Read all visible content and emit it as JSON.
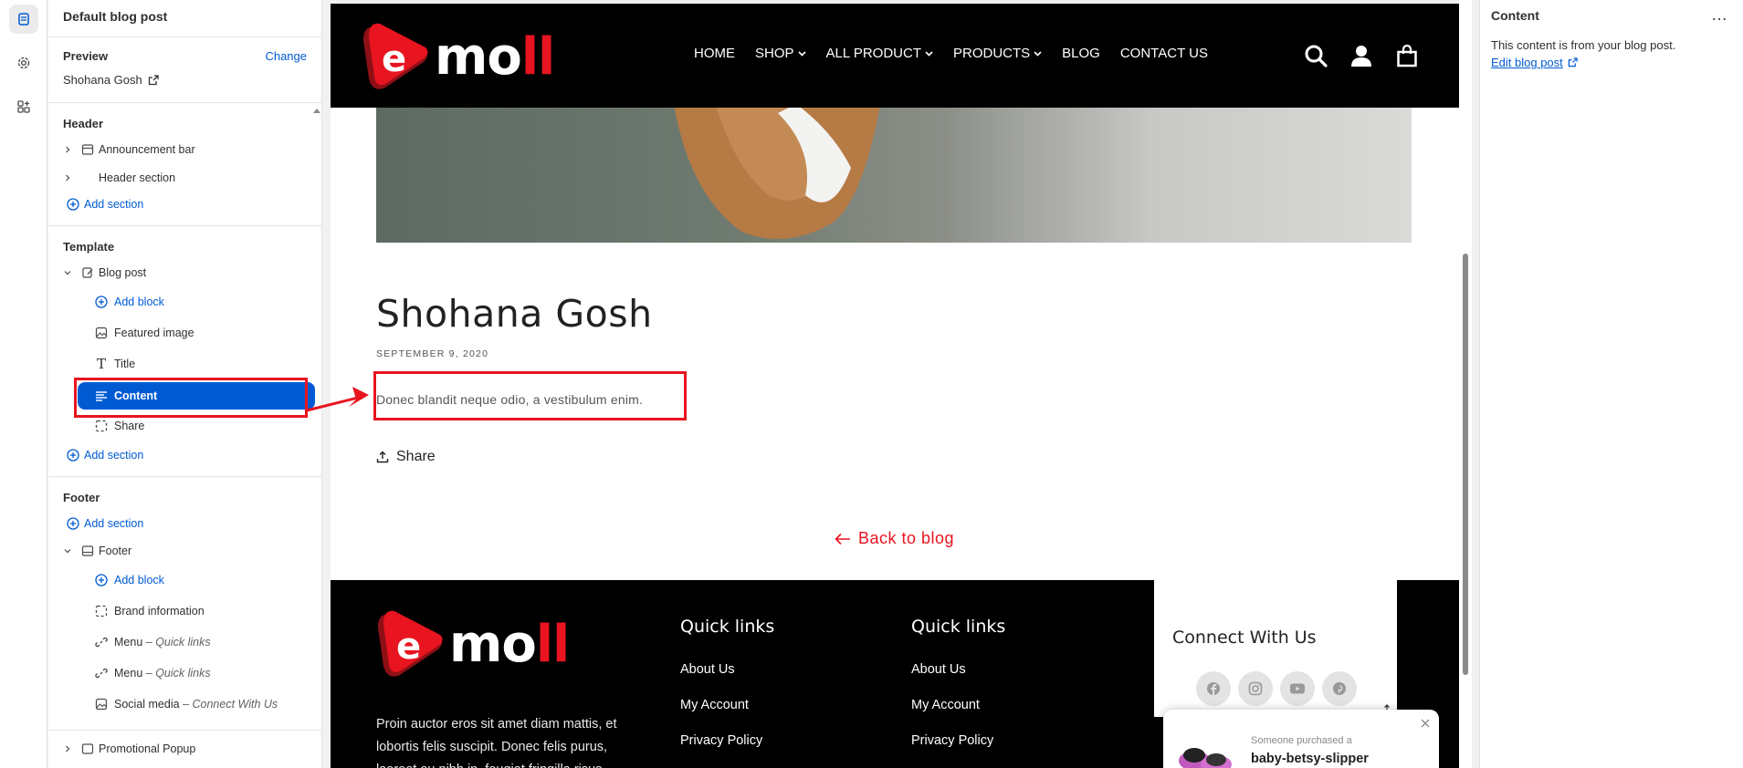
{
  "sidebar": {
    "title": "Default blog post",
    "preview_label": "Preview",
    "change_label": "Change",
    "preview_value": "Shohana Gosh",
    "header_group": "Header",
    "announcement_bar": "Announcement bar",
    "header_section": "Header section",
    "add_section": "Add section",
    "template_group": "Template",
    "blog_post": "Blog post",
    "add_block": "Add block",
    "featured_image": "Featured image",
    "title_block": "Title",
    "content_block": "Content",
    "share_block": "Share",
    "footer_group": "Footer",
    "footer_section": "Footer",
    "brand_information": "Brand information",
    "menu_1": "Menu",
    "menu_1_sub": "Quick links",
    "menu_2": "Menu",
    "menu_2_sub": "Quick links",
    "social_media": "Social media",
    "social_media_sub": "Connect With Us",
    "promotional_popup": "Promotional Popup",
    "dash": "–"
  },
  "preview": {
    "logo_letter": "e",
    "logo_text_white": "mo",
    "logo_text_red": "ll",
    "nav": [
      "HOME",
      "SHOP",
      "ALL PRODUCT",
      "PRODUCTS",
      "BLOG",
      "CONTACT US"
    ],
    "post_title": "Shohana Gosh",
    "post_date": "SEPTEMBER 9, 2020",
    "post_content": "Donec blandit neque odio, a vestibulum enim.",
    "share_label": "Share",
    "back_label": "Back to blog",
    "footer": {
      "quick_links_1": "Quick links",
      "quick_links_2": "Quick links",
      "links_1": [
        "About Us",
        "My Account",
        "Privacy Policy"
      ],
      "links_2": [
        "About Us",
        "My Account",
        "Privacy Policy"
      ],
      "about_lines": [
        "Proin auctor eros sit amet diam mattis, et",
        "lobortis felis suscipit. Donec felis purus,",
        "laoreet eu nibh in, feugiat fringilla risus."
      ],
      "connect_title": "Connect With Us",
      "social_icons": [
        "facebook-icon",
        "instagram-icon",
        "youtube-icon",
        "pinterest-icon"
      ]
    },
    "purchase_popup": {
      "small": "Someone purchased a",
      "product": "baby-betsy-slipper"
    }
  },
  "right_panel": {
    "title": "Content",
    "more": "…",
    "text": "This content is from your blog post.",
    "link": "Edit blog post"
  },
  "colors": {
    "accent": "#005bd3",
    "brand_red": "#e8141f",
    "annotation_red": "#e8141f"
  }
}
